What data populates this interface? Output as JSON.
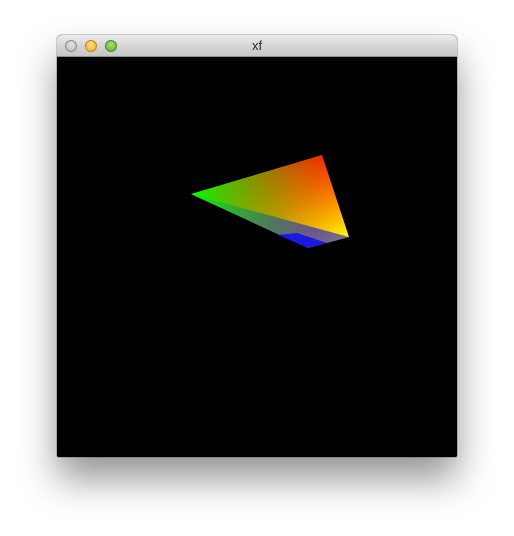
{
  "window": {
    "title": "xf",
    "buttons": {
      "close": "close",
      "minimize": "minimize",
      "zoom": "zoom"
    }
  },
  "viewport": {
    "background": "#000000",
    "shape_colors": [
      "#ff0000",
      "#00ff00",
      "#0000ff",
      "#ffff00"
    ]
  }
}
